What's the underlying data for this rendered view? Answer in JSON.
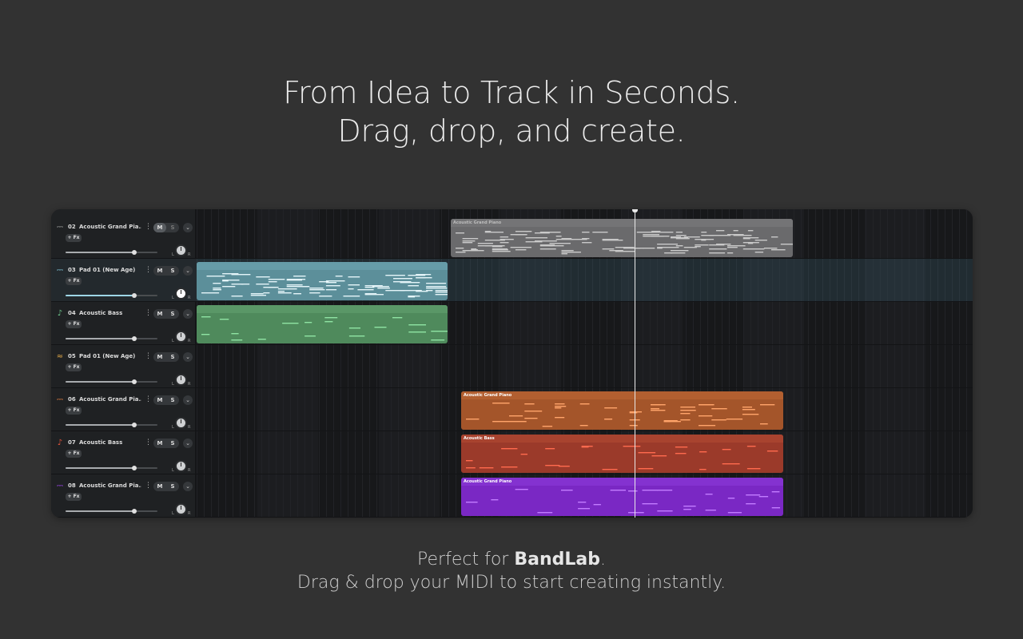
{
  "headline": {
    "line1": "From Idea to Track in Seconds.",
    "line2": "Drag, drop, and create."
  },
  "footer": {
    "prefix": "Perfect for ",
    "brand": "BandLab",
    "suffix": ".",
    "line2": "Drag & drop your MIDI to start creating instantly."
  },
  "track_controls": {
    "mute": "M",
    "solo": "S",
    "fx": "+ Fx",
    "pan_left": "L",
    "pan_right": "R"
  },
  "tracks": [
    {
      "num": "02",
      "name": "Acoustic Grand Pia...",
      "icon": "piano-icon",
      "color": "#9a9a9a",
      "mute_on": true,
      "solo_dim": true,
      "selected": false,
      "volume": 0.75
    },
    {
      "num": "03",
      "name": "Pad 01 (New Age)",
      "icon": "piano-icon",
      "color": "#7fc3d6",
      "mute_on": false,
      "solo_dim": false,
      "selected": true,
      "volume": 0.75
    },
    {
      "num": "04",
      "name": "Acoustic Bass",
      "icon": "bass-icon",
      "color": "#6cc58a",
      "mute_on": false,
      "solo_dim": false,
      "selected": false,
      "volume": 0.75
    },
    {
      "num": "05",
      "name": "Pad 01 (New Age)",
      "icon": "pad-wave-icon",
      "color": "#e0a848",
      "mute_on": false,
      "solo_dim": false,
      "selected": false,
      "volume": 0.75
    },
    {
      "num": "06",
      "name": "Acoustic Grand Pia...",
      "icon": "piano-icon",
      "color": "#e07d40",
      "mute_on": false,
      "solo_dim": false,
      "selected": false,
      "volume": 0.75
    },
    {
      "num": "07",
      "name": "Acoustic Bass",
      "icon": "bass-icon",
      "color": "#e2533a",
      "mute_on": false,
      "solo_dim": false,
      "selected": false,
      "volume": 0.75
    },
    {
      "num": "08",
      "name": "Acoustic Grand Pia...",
      "icon": "piano-icon",
      "color": "#9b45e8",
      "mute_on": false,
      "solo_dim": false,
      "selected": false,
      "volume": 0.75
    }
  ],
  "clips": [
    {
      "lane": 0,
      "label": "Acoustic Grand Piano",
      "color": "#6a6a6c",
      "header": "#747476",
      "note": "#c9c9c9",
      "label_color": "#bdbdbd"
    },
    {
      "lane": 1,
      "label": "",
      "color": "#5c8f9a",
      "header": "#669ca8",
      "note": "#e4f4f8",
      "label_color": "#ffffff"
    },
    {
      "lane": 2,
      "label": "",
      "color": "#4f8a5c",
      "header": "#5a9767",
      "note": "#8fe3a3",
      "label_color": "#ffffff"
    },
    {
      "lane": 4,
      "label": "Acoustic Grand Piano",
      "color": "#a4552a",
      "header": "#b25f30",
      "note": "#ffa46a",
      "label_color": "#ffffff"
    },
    {
      "lane": 5,
      "label": "Acoustic Bass",
      "color": "#9b3a2a",
      "header": "#a8432f",
      "note": "#ff6a4e",
      "label_color": "#ffffff"
    },
    {
      "lane": 6,
      "label": "Acoustic Grand Piano",
      "color": "#7a28c4",
      "header": "#8432d0",
      "note": "#c27cff",
      "label_color": "#ffffff"
    }
  ]
}
